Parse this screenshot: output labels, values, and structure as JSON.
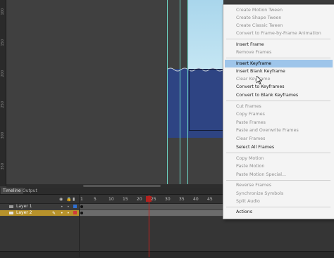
{
  "ruler": {
    "marks": [
      "100",
      "150",
      "200",
      "250",
      "300",
      "350"
    ]
  },
  "timeline": {
    "tabs": [
      "Timeline",
      "Output"
    ],
    "frame_numbers": [
      "1",
      "5",
      "10",
      "15",
      "20",
      "25",
      "30",
      "35",
      "40",
      "45"
    ],
    "layers": [
      {
        "name": "Layer 1",
        "selected": false
      },
      {
        "name": "Layer 2",
        "selected": true
      }
    ],
    "current_frame": 25
  },
  "context_menu": {
    "items": [
      {
        "label": "Create Motion Tween",
        "enabled": false
      },
      {
        "label": "Create Shape Tween",
        "enabled": false
      },
      {
        "label": "Create Classic Tween",
        "enabled": false
      },
      {
        "label": "Convert to Frame-by-Frame Animation",
        "enabled": false
      },
      {
        "label": "Insert Frame",
        "enabled": true
      },
      {
        "label": "Remove Frames",
        "enabled": false
      },
      {
        "label": "Insert Keyframe",
        "enabled": true,
        "highlighted": true
      },
      {
        "label": "Insert Blank Keyframe",
        "enabled": true
      },
      {
        "label": "Clear Keyframe",
        "enabled": false
      },
      {
        "label": "Convert to Keyframes",
        "enabled": true
      },
      {
        "label": "Convert to Blank Keyframes",
        "enabled": true
      },
      {
        "label": "Cut Frames",
        "enabled": false
      },
      {
        "label": "Copy Frames",
        "enabled": false
      },
      {
        "label": "Paste Frames",
        "enabled": false
      },
      {
        "label": "Paste and Overwrite Frames",
        "enabled": false
      },
      {
        "label": "Clear Frames",
        "enabled": false
      },
      {
        "label": "Select All Frames",
        "enabled": true
      },
      {
        "label": "Copy Motion",
        "enabled": false
      },
      {
        "label": "Paste Motion",
        "enabled": false
      },
      {
        "label": "Paste Motion Special...",
        "enabled": false
      },
      {
        "label": "Reverse Frames",
        "enabled": false
      },
      {
        "label": "Synchronize Symbols",
        "enabled": false
      },
      {
        "label": "Split Audio",
        "enabled": false
      },
      {
        "label": "Actions",
        "enabled": true
      }
    ]
  },
  "colors": {
    "water": "#2e4483",
    "sky": "#a9d6ec",
    "guide": "#6dd6c4",
    "selected_layer": "#b7922b",
    "playhead": "#c8201c",
    "menu_highlight": "#9ec5ea"
  }
}
